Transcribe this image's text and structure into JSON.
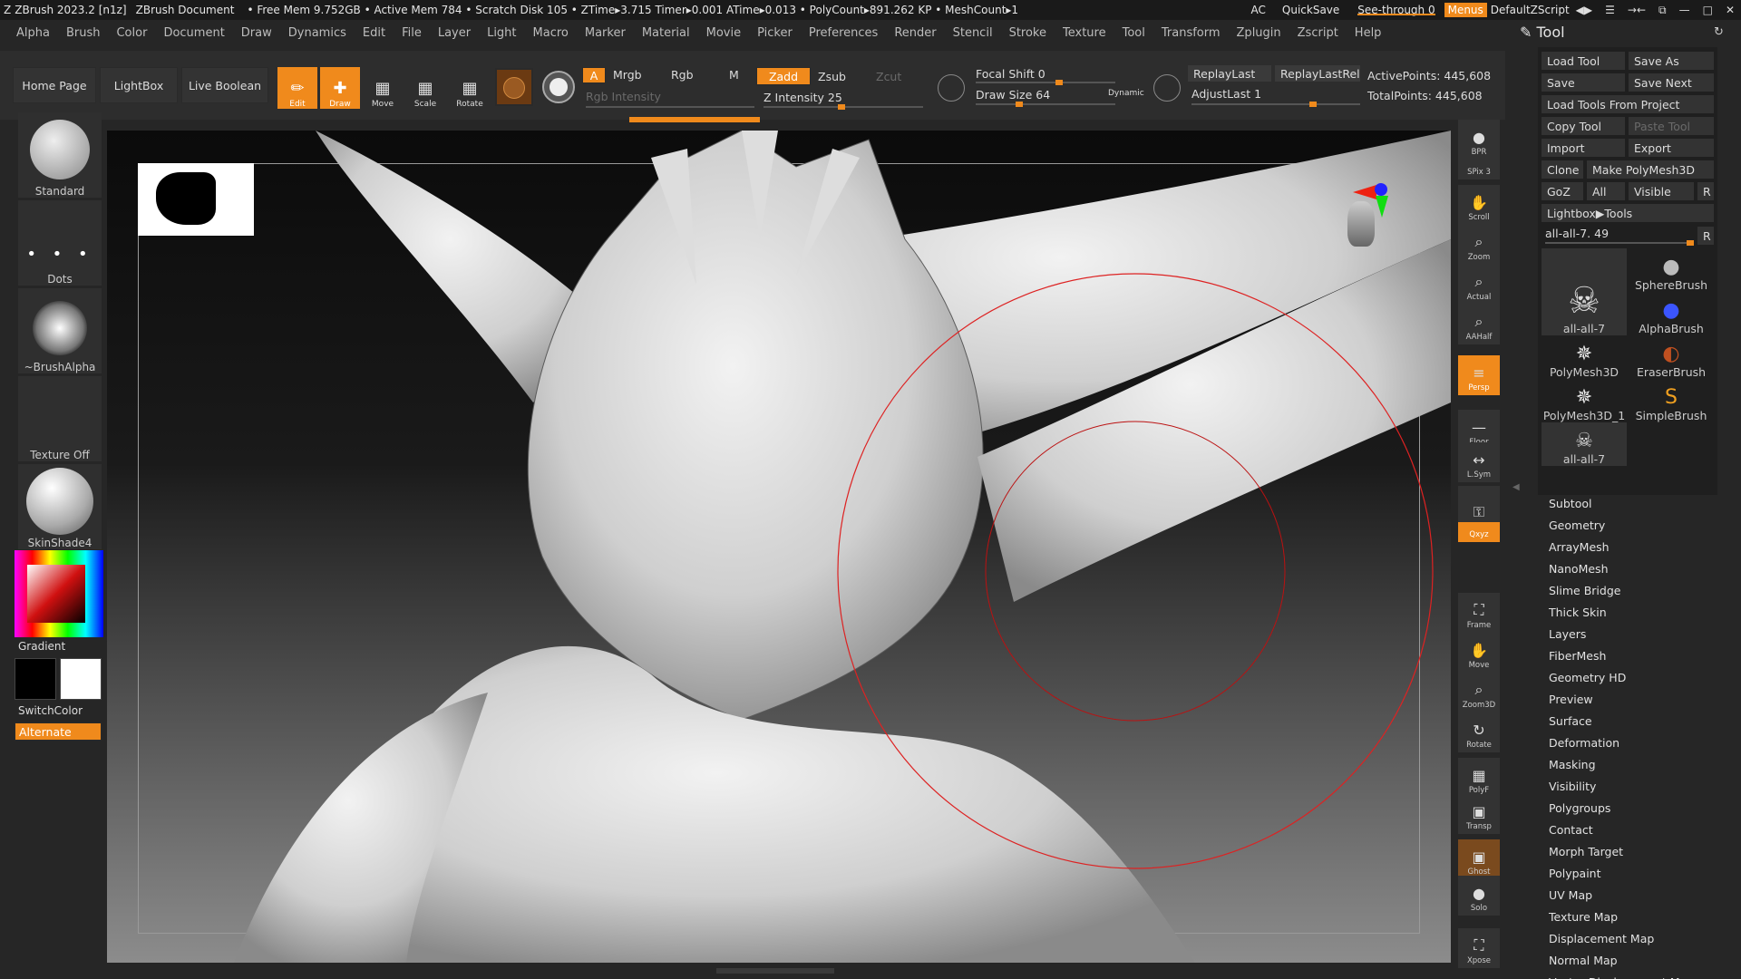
{
  "titlebar": {
    "app": "ZBrush 2023.2 [n1z]",
    "doc": "ZBrush Document",
    "stats": "• Free Mem 9.752GB • Active Mem 784 • Scratch Disk 105 • ZTime▸3.715 Timer▸0.001 ATime▸0.013 • PolyCount▸891.262 KP • MeshCount▸1",
    "ac": "AC",
    "quicksave": "QuickSave",
    "seethrough": "See-through  0",
    "seethrough_value": 0,
    "menus": "Menus",
    "script": "DefaultZScript",
    "window_icons": [
      "◀▶",
      "☰",
      "→←",
      "⧉",
      "—",
      "□",
      "✕"
    ]
  },
  "menubar": [
    "Alpha",
    "Brush",
    "Color",
    "Document",
    "Draw",
    "Dynamics",
    "Edit",
    "File",
    "Layer",
    "Light",
    "Macro",
    "Marker",
    "Material",
    "Movie",
    "Picker",
    "Preferences",
    "Render",
    "Stencil",
    "Stroke",
    "Texture",
    "Tool",
    "Transform",
    "Zplugin",
    "Zscript",
    "Help"
  ],
  "toolbar": {
    "home": "Home Page",
    "lightbox": "LightBox",
    "liveboolean": "Live Boolean",
    "edit": "Edit",
    "draw": "Draw",
    "move": "Move",
    "scale": "Scale",
    "rotate": "Rotate",
    "a": "A",
    "mrgb": "Mrgb",
    "rgb": "Rgb",
    "m": "M",
    "zadd": "Zadd",
    "zsub": "Zsub",
    "zcut": "Zcut",
    "rgb_intensity": "Rgb Intensity",
    "z_intensity": "Z Intensity 25",
    "z_intensity_value": 25,
    "focal_shift": "Focal Shift 0",
    "focal_shift_value": 0,
    "draw_size": "Draw Size 64",
    "draw_size_value": 64,
    "dynamic": "Dynamic",
    "replay_last": "ReplayLast",
    "replay_last_rel": "ReplayLastRel",
    "adjust_last": "AdjustLast 1",
    "active_points": "ActivePoints: 445,608",
    "total_points": "TotalPoints: 445,608"
  },
  "leftshelf": {
    "standard": "Standard",
    "dots": "Dots",
    "alpha": "~BrushAlpha",
    "texture": "Texture Off",
    "material": "SkinShade4",
    "gradient": "Gradient",
    "switchcolor": "SwitchColor",
    "alternate": "Alternate"
  },
  "righttools": [
    {
      "name": "bpr",
      "label": "BPR",
      "icon": "●"
    },
    {
      "name": "spix",
      "label": "SPix 3",
      "icon": ""
    },
    {
      "name": "scroll",
      "label": "Scroll",
      "icon": "✋"
    },
    {
      "name": "zoom",
      "label": "Zoom",
      "icon": "⌕"
    },
    {
      "name": "actual",
      "label": "Actual",
      "icon": "⌕"
    },
    {
      "name": "aahalf",
      "label": "AAHalf",
      "icon": "⌕"
    },
    {
      "name": "persp",
      "label": "Persp",
      "icon": "≡"
    },
    {
      "name": "floor",
      "label": "Floor",
      "icon": "—"
    },
    {
      "name": "lsym",
      "label": "L.Sym",
      "icon": "↔"
    },
    {
      "name": "lock",
      "label": "",
      "icon": "⚿"
    },
    {
      "name": "xyz",
      "label": "Qxyz",
      "icon": ""
    },
    {
      "name": "frame",
      "label": "Frame",
      "icon": "⛶"
    },
    {
      "name": "move",
      "label": "Move",
      "icon": "✋"
    },
    {
      "name": "zoom3d",
      "label": "Zoom3D",
      "icon": "⌕"
    },
    {
      "name": "rotate",
      "label": "Rotate",
      "icon": "↻"
    },
    {
      "name": "polyf",
      "label": "PolyF",
      "icon": "▦"
    },
    {
      "name": "transp",
      "label": "Transp",
      "icon": "▣"
    },
    {
      "name": "ghost",
      "label": "Ghost",
      "icon": "▣"
    },
    {
      "name": "solo",
      "label": "Solo",
      "icon": "●"
    },
    {
      "name": "xpose",
      "label": "Xpose",
      "icon": "⛶"
    }
  ],
  "rpanel": {
    "title": "Tool",
    "load_tool": "Load Tool",
    "save_as": "Save As",
    "save": "Save",
    "save_next": "Save Next",
    "load_from_project": "Load Tools From Project",
    "copy_tool": "Copy Tool",
    "paste_tool": "Paste Tool",
    "import": "Import",
    "export": "Export",
    "clone": "Clone",
    "make_polymesh": "Make PolyMesh3D",
    "goz": "GoZ",
    "all": "All",
    "visible": "Visible",
    "r": "R",
    "lightbox_tools": "Lightbox▶Tools",
    "current_tool": "all-all-7. 49",
    "tiles": [
      "all-all-7",
      "SphereBrush",
      "AlphaBrush",
      "PolyMesh3D",
      "EraserBrush",
      "PolyMesh3D_1",
      "SimpleBrush",
      "all-all-7"
    ],
    "sections": [
      "Subtool",
      "Geometry",
      "ArrayMesh",
      "NanoMesh",
      "Slime Bridge",
      "Thick Skin",
      "Layers",
      "FiberMesh",
      "Geometry HD",
      "Preview",
      "Surface",
      "Deformation",
      "Masking",
      "Visibility",
      "Polygroups",
      "Contact",
      "Morph Target",
      "Polypaint",
      "UV Map",
      "Texture Map",
      "Displacement Map",
      "Normal Map",
      "Vector Displacement Map"
    ]
  },
  "colors": {
    "accent": "#f08a1c",
    "bg": "#262626"
  }
}
